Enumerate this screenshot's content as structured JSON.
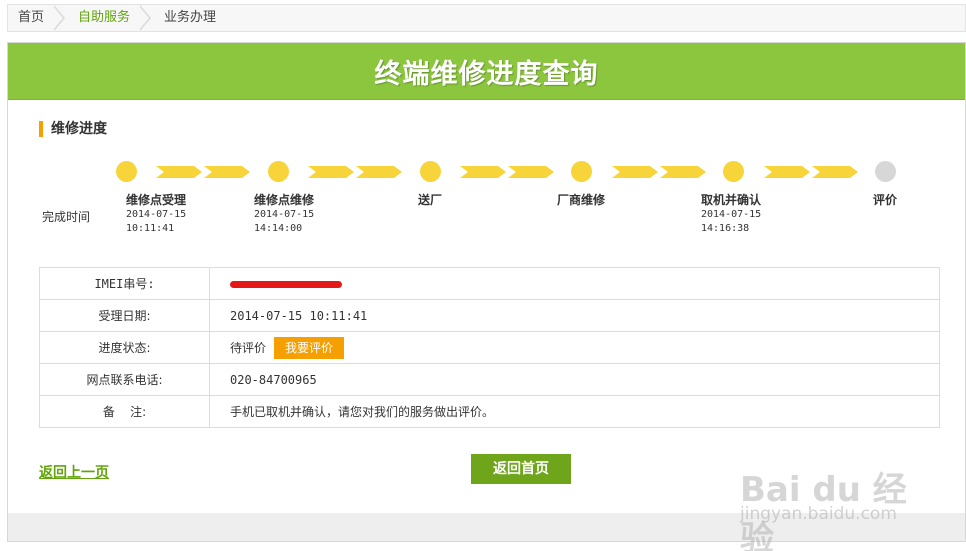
{
  "breadcrumb": [
    "首页",
    "自助服务",
    "业务办理"
  ],
  "banner_title": "终端维修进度查询",
  "section_title": "维修进度",
  "complete_time_label": "完成时间",
  "steps": [
    {
      "name": "维修点受理",
      "date": "2014-07-15",
      "time": "10:11:41",
      "done": true
    },
    {
      "name": "维修点维修",
      "date": "2014-07-15",
      "time": "14:14:00",
      "done": true
    },
    {
      "name": "送厂",
      "date": "",
      "time": "",
      "done": true
    },
    {
      "name": "厂商维修",
      "date": "",
      "time": "",
      "done": true
    },
    {
      "name": "取机并确认",
      "date": "2014-07-15",
      "time": "14:16:38",
      "done": true
    },
    {
      "name": "评价",
      "date": "",
      "time": "",
      "done": false
    }
  ],
  "info": {
    "imei_label": "IMEI串号:",
    "date_label": "受理日期:",
    "date_value": "2014-07-15 10:11:41",
    "status_label": "进度状态:",
    "status_value": "待评价",
    "rate_button": "我要评价",
    "phone_label": "网点联系电话:",
    "phone_value": "020-84700965",
    "note_label": "备    注:",
    "note_value": "手机已取机并确认，请您对我们的服务做出评价。"
  },
  "back_link": "返回上一页",
  "home_button": "返回首页",
  "watermark": {
    "logo": "Bai du 经验",
    "url": "jingyan.baidu.com"
  },
  "colors": {
    "accent_green": "#8cc63f",
    "dot_yellow": "#f7d43a",
    "orange": "#f5a000"
  }
}
